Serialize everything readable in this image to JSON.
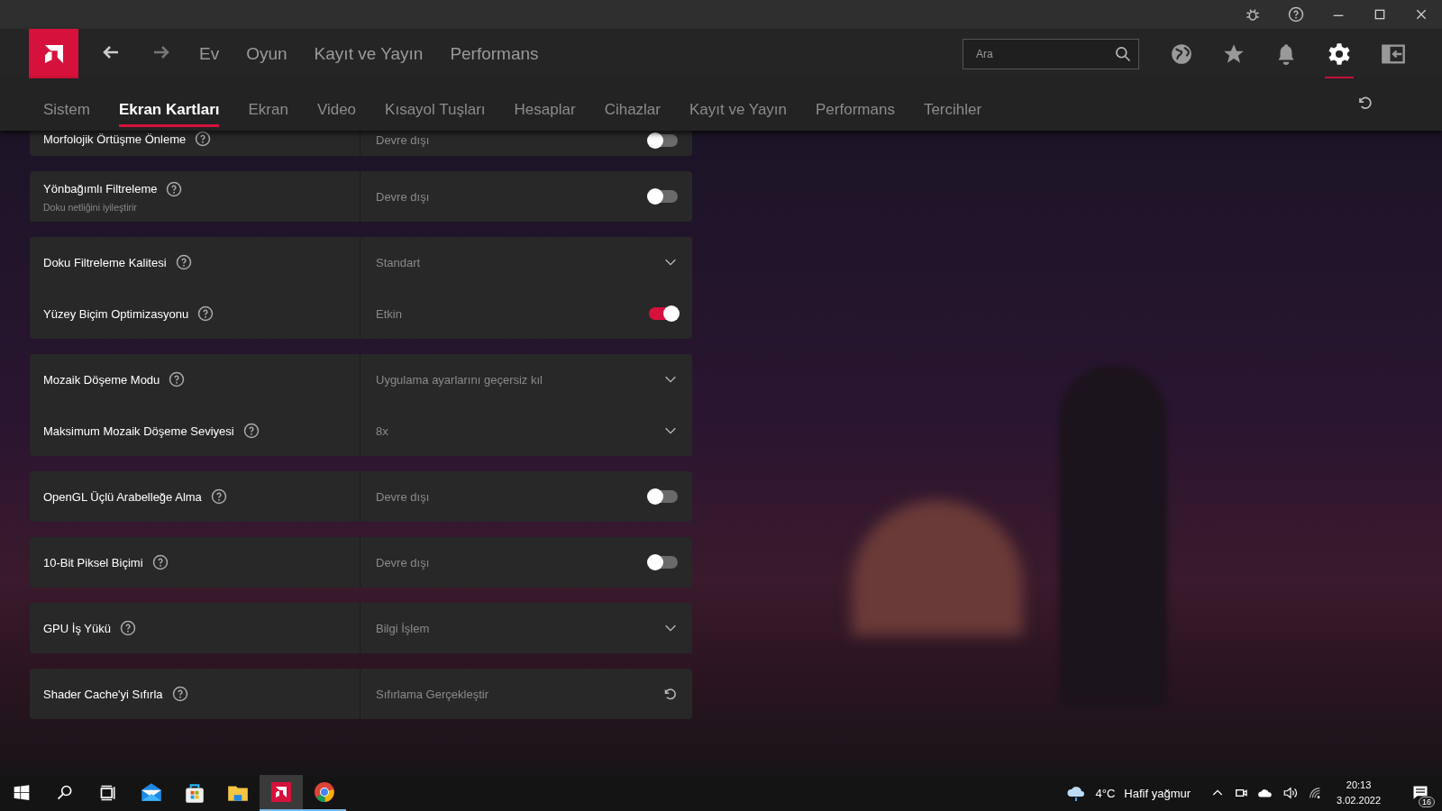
{
  "top_nav": {
    "items": [
      {
        "label": "Ev",
        "selected": false
      },
      {
        "label": "Oyun",
        "selected": false
      },
      {
        "label": "Kayıt ve Yayın",
        "selected": false
      },
      {
        "label": "Performans",
        "selected": false
      }
    ],
    "search": {
      "placeholder": "Ara"
    }
  },
  "sub_nav": {
    "tabs": [
      {
        "label": "Sistem",
        "selected": false
      },
      {
        "label": "Ekran Kartları",
        "selected": true
      },
      {
        "label": "Ekran",
        "selected": false
      },
      {
        "label": "Video",
        "selected": false
      },
      {
        "label": "Kısayol Tuşları",
        "selected": false
      },
      {
        "label": "Hesaplar",
        "selected": false
      },
      {
        "label": "Cihazlar",
        "selected": false
      },
      {
        "label": "Kayıt ve Yayın",
        "selected": false
      },
      {
        "label": "Performans",
        "selected": false
      },
      {
        "label": "Tercihler",
        "selected": false
      }
    ]
  },
  "settings": [
    {
      "rows": [
        {
          "kind": "toggle",
          "label": "Morfolojik Örtüşme Önleme",
          "value": "Devre dışı",
          "on": false
        }
      ]
    },
    {
      "rows": [
        {
          "kind": "toggle",
          "label": "Yönbağımlı Filtreleme",
          "sublabel": "Doku netliğini iyileştirir",
          "value": "Devre dışı",
          "on": false
        }
      ]
    },
    {
      "rows": [
        {
          "kind": "dropdown",
          "label": "Doku Filtreleme Kalitesi",
          "value": "Standart"
        },
        {
          "kind": "toggle",
          "label": "Yüzey Biçim Optimizasyonu",
          "value": "Etkin",
          "on": true
        }
      ]
    },
    {
      "rows": [
        {
          "kind": "dropdown",
          "label": "Mozaik Döşeme Modu",
          "value": "Uygulama ayarlarını geçersiz kıl"
        },
        {
          "kind": "dropdown",
          "label": "Maksimum Mozaik Döşeme Seviyesi",
          "value": "8x"
        }
      ]
    },
    {
      "rows": [
        {
          "kind": "toggle",
          "label": "OpenGL Üçlü Arabelleğe Alma",
          "value": "Devre dışı",
          "on": false
        }
      ]
    },
    {
      "rows": [
        {
          "kind": "toggle",
          "label": "10-Bit Piksel Biçimi",
          "value": "Devre dışı",
          "on": false
        }
      ]
    },
    {
      "rows": [
        {
          "kind": "dropdown",
          "label": "GPU İş Yükü",
          "value": "Bilgi İşlem"
        }
      ]
    },
    {
      "rows": [
        {
          "kind": "action",
          "label": "Shader Cache'yi Sıfırla",
          "value": "Sıfırlama Gerçekleştir"
        }
      ]
    }
  ],
  "taskbar": {
    "weather": {
      "temperature": "4°C",
      "condition": "Hafif yağmur"
    },
    "time": "20:13",
    "date": "3.02.2022",
    "notification_count": "16"
  }
}
